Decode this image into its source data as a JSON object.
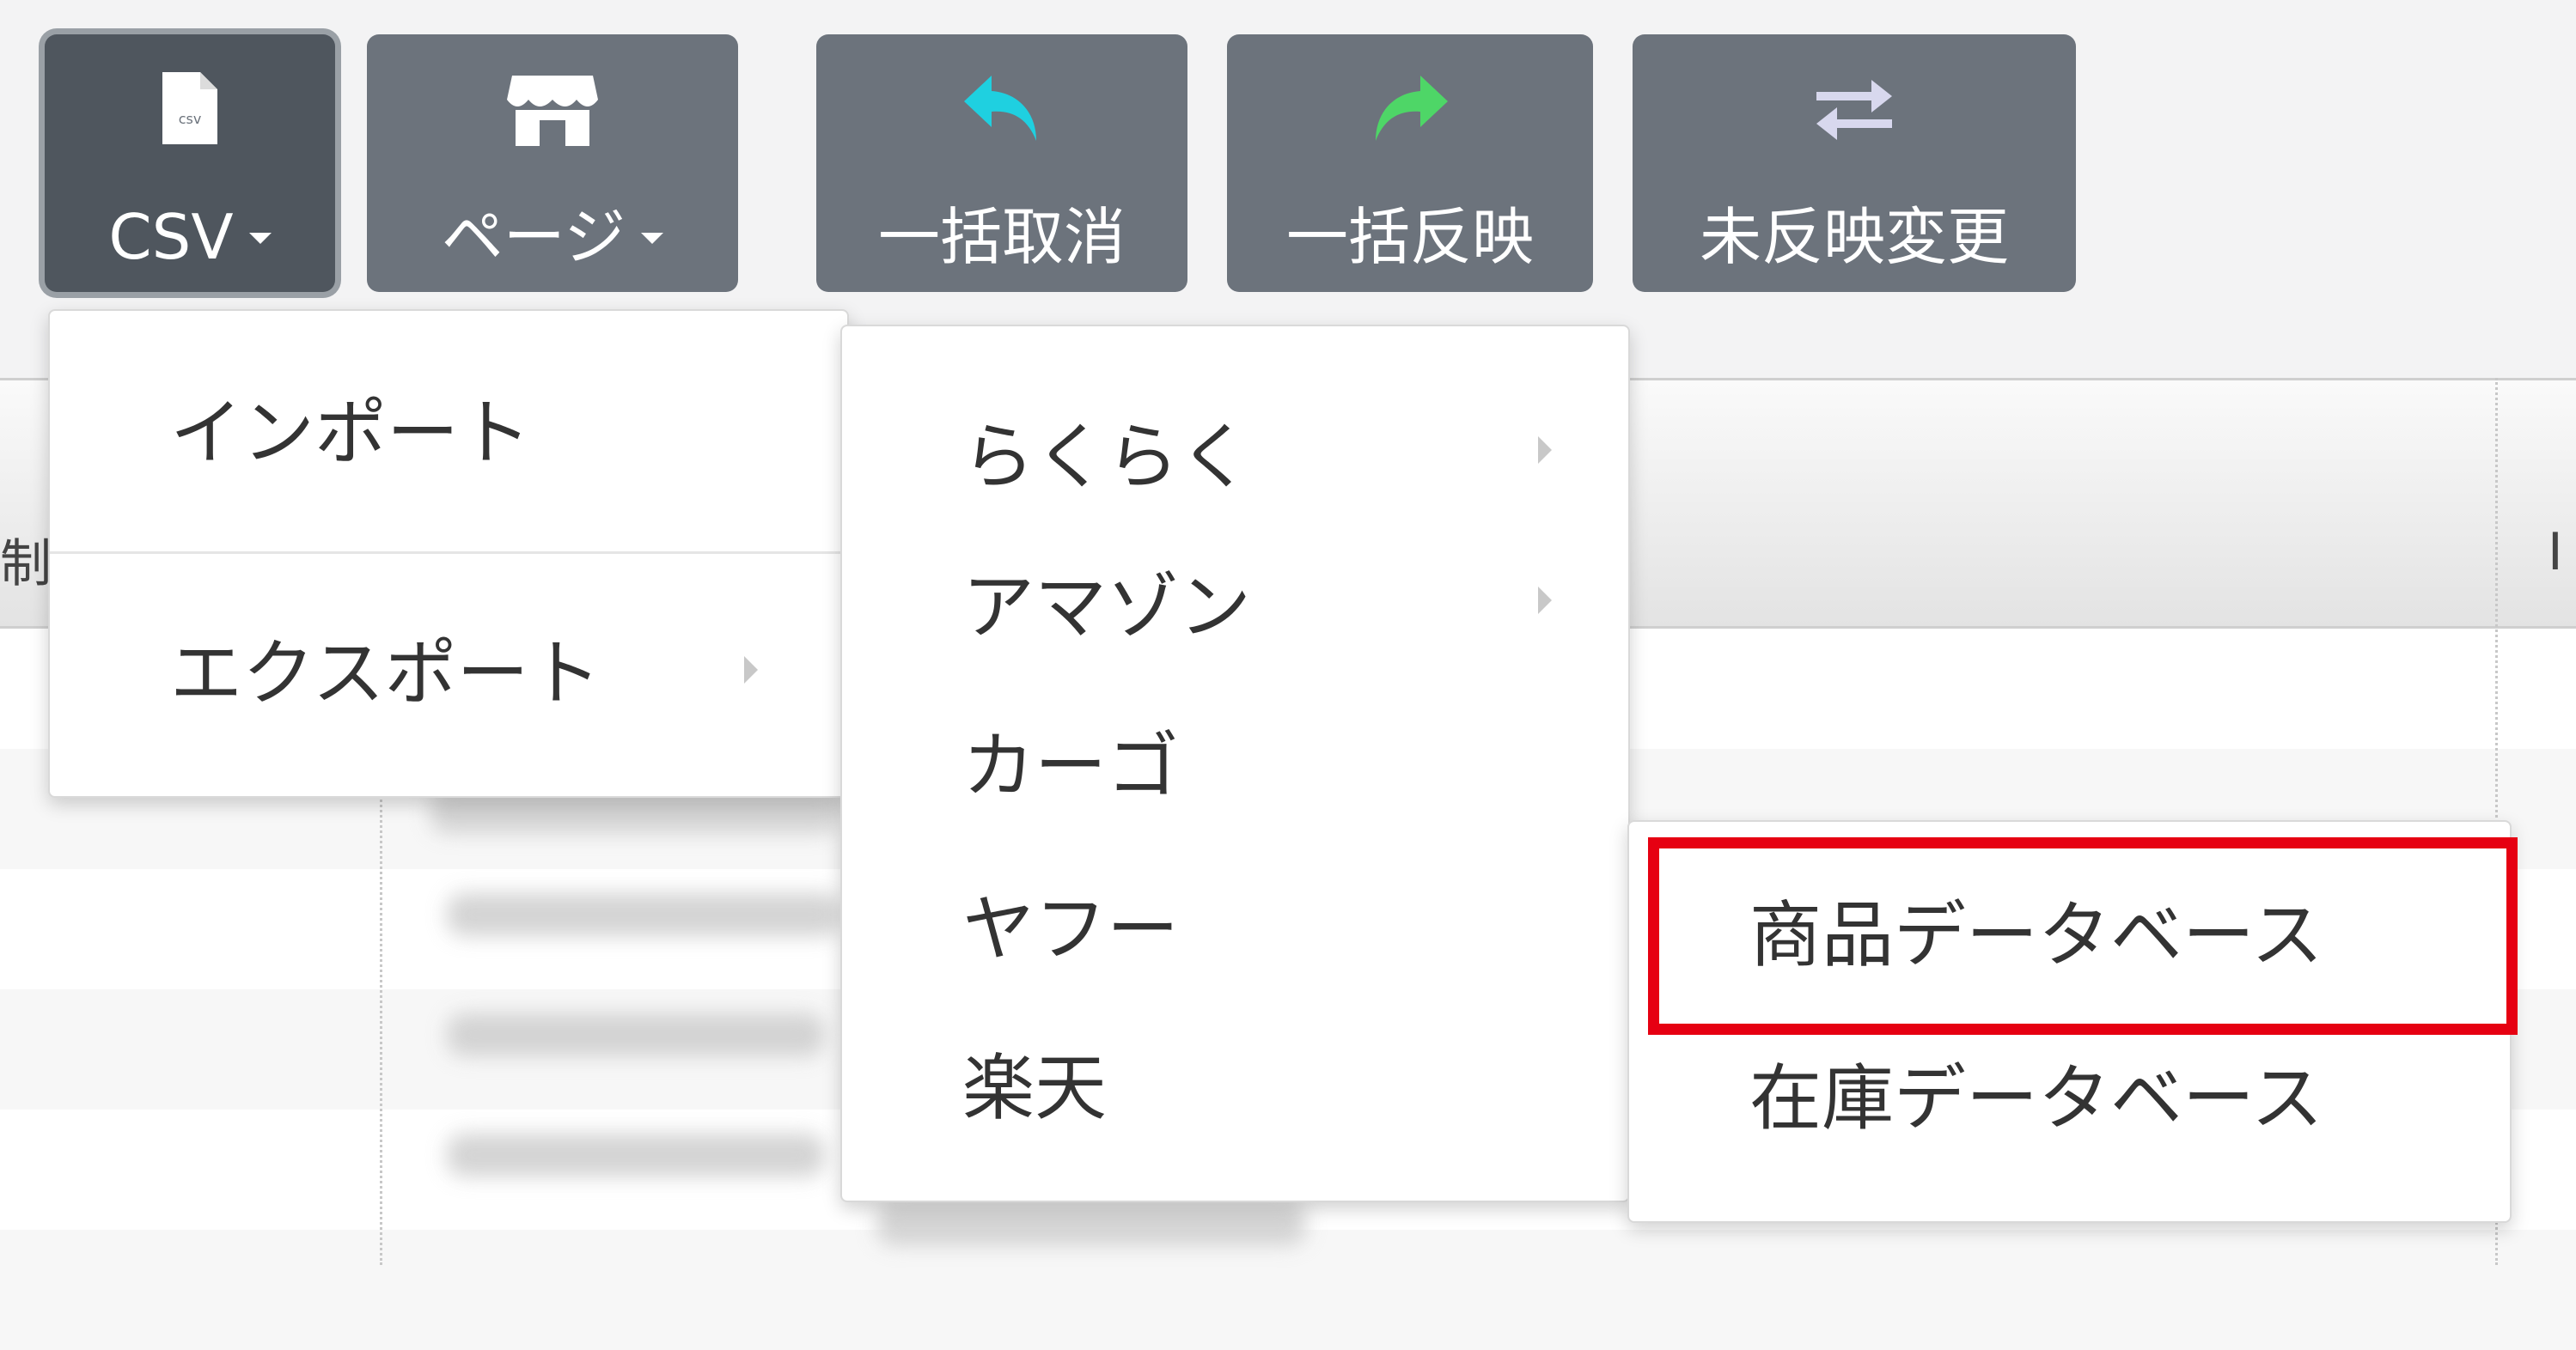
{
  "toolbar": {
    "buttons": [
      {
        "label": "CSV",
        "icon": "csv-file-icon",
        "has_caret": true,
        "active": true
      },
      {
        "label": "ページ",
        "icon": "store-icon",
        "has_caret": true,
        "active": false
      },
      {
        "label": "一括取消",
        "icon": "undo-arrow-icon",
        "icon_color": "#1fd0e0"
      },
      {
        "label": "一括反映",
        "icon": "redo-arrow-icon",
        "icon_color": "#4ed667"
      },
      {
        "label": "未反映変更",
        "icon": "swap-arrows-icon",
        "icon_color": "#d8d8ee"
      }
    ],
    "button_color": "#6c737c",
    "active_button_color": "#4f565e"
  },
  "csv_menu": {
    "items": [
      {
        "label": "インポート",
        "has_submenu": false
      },
      {
        "label": "エクスポート",
        "has_submenu": true
      }
    ]
  },
  "export_submenu": {
    "items": [
      {
        "label": "らくらく",
        "has_submenu": true
      },
      {
        "label": "アマゾン",
        "has_submenu": true
      },
      {
        "label": "カーゴ",
        "has_submenu": false
      },
      {
        "label": "ヤフー",
        "has_submenu": false
      },
      {
        "label": "楽天",
        "has_submenu": false
      }
    ]
  },
  "database_submenu": {
    "items": [
      {
        "label": "商品データベース",
        "highlighted": true
      },
      {
        "label": "在庫データベース",
        "highlighted": false
      }
    ],
    "highlight_color": "#e60012"
  },
  "grid": {
    "partial_header_left": "制工",
    "partial_header_right": "I"
  }
}
